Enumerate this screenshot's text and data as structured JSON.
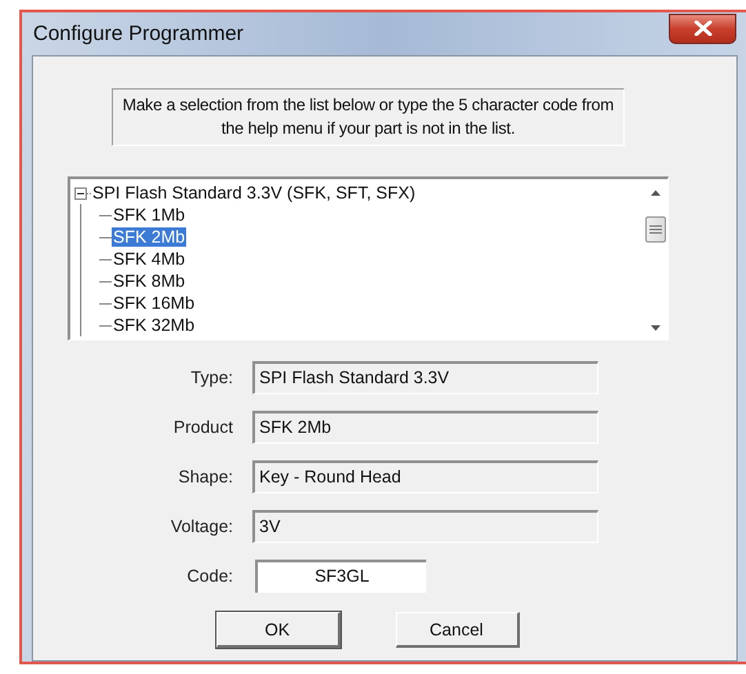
{
  "window": {
    "title": "Configure Programmer"
  },
  "instructions": "Make a selection from the list below or type the 5 character code from the help menu if your part is not in the list.",
  "tree": [
    {
      "label": "SPI Flash Standard 3.3V (SFK, SFT, SFX)",
      "expanded": true,
      "selected": false,
      "children": [
        {
          "label": "SFK 1Mb",
          "selected": false
        },
        {
          "label": "SFK 2Mb",
          "selected": true
        },
        {
          "label": "SFK 4Mb",
          "selected": false
        },
        {
          "label": "SFK 8Mb",
          "selected": false
        },
        {
          "label": "SFK 16Mb",
          "selected": false
        },
        {
          "label": "SFK 32Mb",
          "selected": false
        }
      ]
    }
  ],
  "fields": [
    {
      "label": "Type:",
      "value": "SPI Flash Standard 3.3V",
      "kind": "readonly"
    },
    {
      "label": "Product",
      "value": "SFK 2Mb",
      "kind": "readonly"
    },
    {
      "label": "Shape:",
      "value": "Key - Round Head",
      "kind": "readonly"
    },
    {
      "label": "Voltage:",
      "value": "3V",
      "kind": "readonly"
    },
    {
      "label": "Code:",
      "value": "SF3GL",
      "kind": "editable"
    }
  ],
  "buttons": [
    "OK",
    "Cancel"
  ]
}
